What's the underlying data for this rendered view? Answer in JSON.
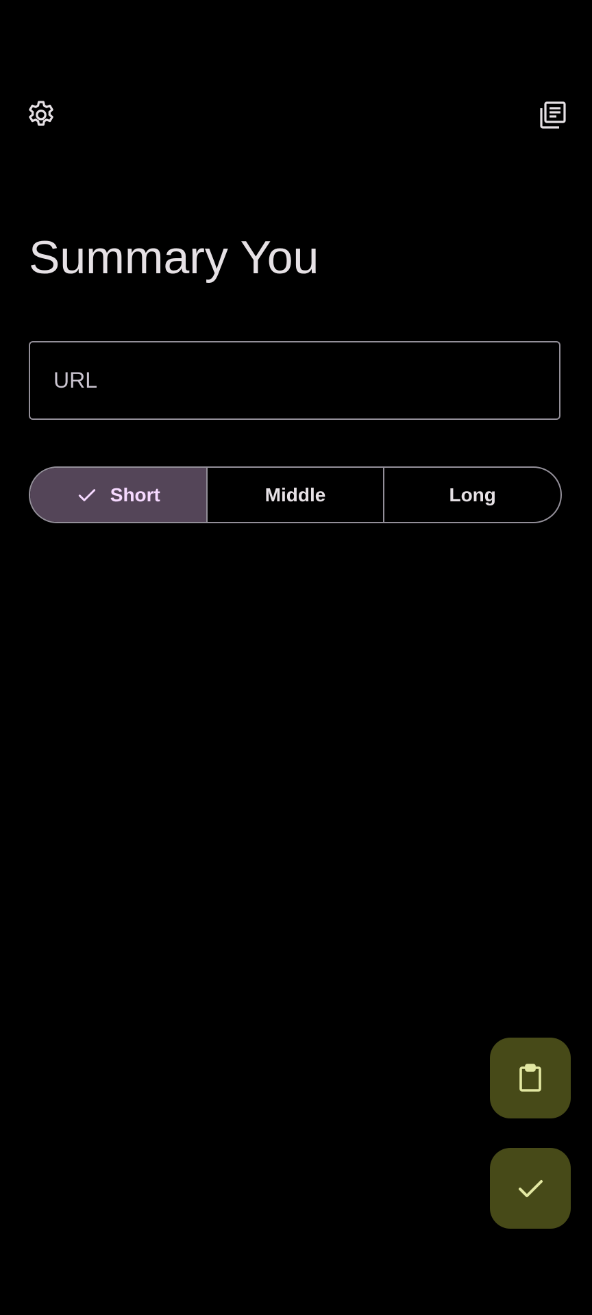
{
  "toolbar": {
    "settings_icon": "gear-icon",
    "history_icon": "history-list-icon"
  },
  "header": {
    "title": "Summary You"
  },
  "url_input": {
    "placeholder": "URL",
    "value": ""
  },
  "length_selector": {
    "options": [
      {
        "label": "Short",
        "selected": true
      },
      {
        "label": "Middle",
        "selected": false
      },
      {
        "label": "Long",
        "selected": false
      }
    ]
  },
  "fabs": {
    "paste_icon": "clipboard-icon",
    "submit_icon": "check-icon"
  },
  "colors": {
    "background": "#000000",
    "outline": "#938f99",
    "selected_segment": "#544558",
    "selected_text": "#f5d9ff",
    "fab_background": "#474a18",
    "fab_icon": "#e3e8a2",
    "text": "#e6e1e5"
  }
}
